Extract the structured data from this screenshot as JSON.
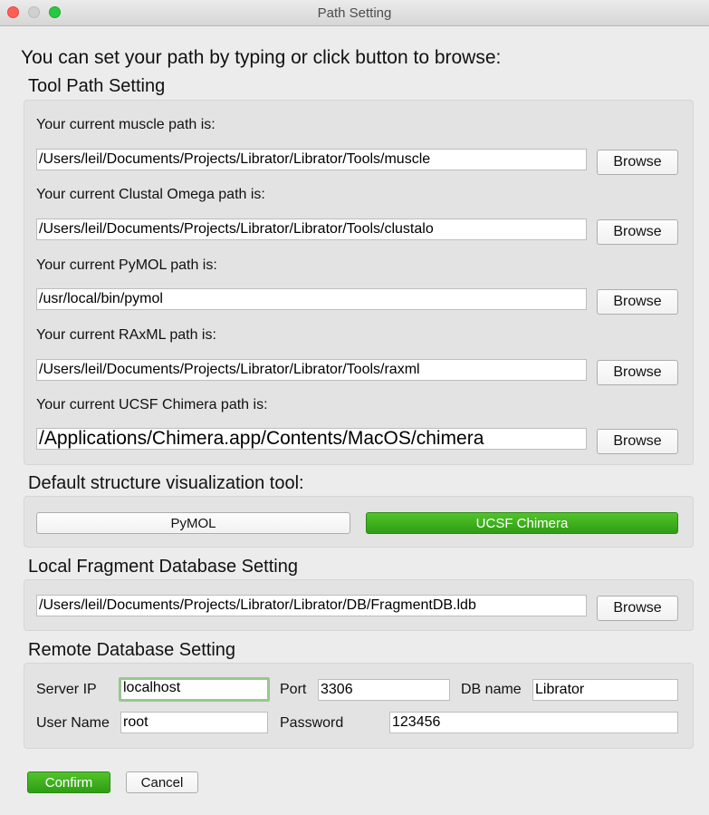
{
  "window": {
    "title": "Path Setting"
  },
  "intro": "You can set your path by typing or click button to browse:",
  "tool_path": {
    "section_title": "Tool Path Setting",
    "browse_label": "Browse",
    "muscle": {
      "label": "Your current muscle path is:",
      "value": "/Users/leil/Documents/Projects/Librator/Librator/Tools/muscle"
    },
    "clustal": {
      "label": "Your current Clustal Omega path is:",
      "value": "/Users/leil/Documents/Projects/Librator/Librator/Tools/clustalo"
    },
    "pymol": {
      "label": "Your current PyMOL path is:",
      "value": "/usr/local/bin/pymol"
    },
    "raxml": {
      "label": "Your current RAxML path is:",
      "value": "/Users/leil/Documents/Projects/Librator/Librator/Tools/raxml"
    },
    "chimera": {
      "label": "Your current UCSF Chimera path is:",
      "value": "/Applications/Chimera.app/Contents/MacOS/chimera"
    }
  },
  "viz_tool": {
    "section_title": "Default structure visualization tool:",
    "options": [
      "PyMOL",
      "UCSF Chimera"
    ],
    "selected": "UCSF Chimera"
  },
  "fragment_db": {
    "section_title": "Local Fragment Database Setting",
    "value": "/Users/leil/Documents/Projects/Librator/Librator/DB/FragmentDB.ldb",
    "browse_label": "Browse"
  },
  "remote_db": {
    "section_title": "Remote Database Setting",
    "server_ip": {
      "label": "Server IP",
      "value": "localhost"
    },
    "port": {
      "label": "Port",
      "value": "3306"
    },
    "db_name": {
      "label": "DB name",
      "value": "Librator"
    },
    "user_name": {
      "label": "User Name",
      "value": "root"
    },
    "password": {
      "label": "Password",
      "value": "123456"
    }
  },
  "actions": {
    "confirm": "Confirm",
    "cancel": "Cancel"
  },
  "colors": {
    "accent_green": "#3aae1c",
    "focus_ring": "#97c88f",
    "background": "#ececec"
  }
}
